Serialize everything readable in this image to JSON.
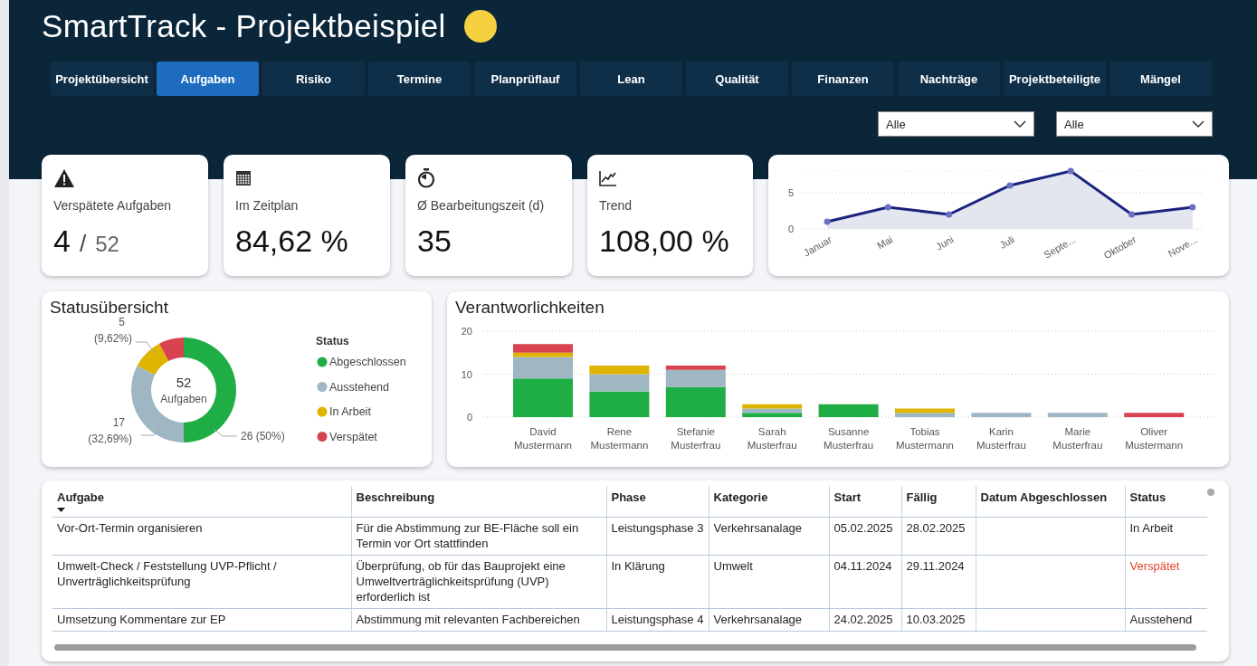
{
  "header": {
    "title": "SmartTrack - Projektbeispiel"
  },
  "tabs": [
    {
      "label": "Projektübersicht",
      "selected": false
    },
    {
      "label": "Aufgaben",
      "selected": true
    },
    {
      "label": "Risiko",
      "selected": false
    },
    {
      "label": "Termine",
      "selected": false
    },
    {
      "label": "Planprüflauf",
      "selected": false
    },
    {
      "label": "Lean",
      "selected": false
    },
    {
      "label": "Qualität",
      "selected": false
    },
    {
      "label": "Finanzen",
      "selected": false
    },
    {
      "label": "Nachträge",
      "selected": false
    },
    {
      "label": "Projektbeteiligte",
      "selected": false
    },
    {
      "label": "Mängel",
      "selected": false
    }
  ],
  "filters": [
    {
      "value": "Alle"
    },
    {
      "value": "Alle"
    }
  ],
  "kpis": [
    {
      "label": "Verspätete Aufgaben",
      "value": "4",
      "separator": "/",
      "total": "52"
    },
    {
      "label": "Im Zeitplan",
      "value": "84,62 %"
    },
    {
      "label": "Ø Bearbeitungszeit (d)",
      "value": "35"
    },
    {
      "label": "Trend",
      "value": "108,00 %"
    }
  ],
  "trend_chart": {
    "chart_data": {
      "type": "area",
      "categories": [
        "Januar",
        "Mai",
        "Juni",
        "Juli",
        "Septe...",
        "Oktober",
        "Nove..."
      ],
      "yticks": [
        0,
        5
      ],
      "ylim": [
        0,
        8
      ],
      "series": [
        {
          "color": "#1a237e",
          "values": [
            1,
            3,
            2,
            6,
            8,
            2,
            3
          ]
        }
      ]
    }
  },
  "status_overview": {
    "title": "Statusübersicht",
    "center_value": "52",
    "center_label": "Aufgaben",
    "legend_title": "Status",
    "slice_labels": [
      {
        "lines": [
          "5",
          "(9,62%)"
        ]
      },
      {
        "lines": [
          "26 (50%)"
        ]
      },
      {
        "lines": [
          "17",
          "(32,69%)"
        ]
      }
    ],
    "chart_data": {
      "type": "donut",
      "legend": "right",
      "categories": [
        "Abgeschlossen",
        "Ausstehend",
        "In Arbeit",
        "Verspätet"
      ],
      "values": [
        50,
        32.69,
        9.62,
        7.69
      ],
      "colors": [
        "#1fad45",
        "#9fb6c3",
        "#dfb400",
        "#d9434f"
      ]
    }
  },
  "responsibilities": {
    "title": "Verantworlichkeiten",
    "chart_data": {
      "type": "bar",
      "stacked": true,
      "yticks": [
        0,
        10,
        20
      ],
      "ylim": [
        0,
        20
      ],
      "categories": [
        [
          "David",
          "Mustermann"
        ],
        [
          "Rene",
          "Mustermann"
        ],
        [
          "Stefanie",
          "Musterfrau"
        ],
        [
          "Sarah",
          "Musterfrau"
        ],
        [
          "Susanne",
          "Musterfrau"
        ],
        [
          "Tobias",
          "Mustermann"
        ],
        [
          "Karin",
          "Musterfrau"
        ],
        [
          "Marie",
          "Musterfrau"
        ],
        [
          "Oliver",
          "Mustermann"
        ]
      ],
      "series": [
        {
          "color": "#1fad45",
          "values": [
            9,
            6,
            7,
            1,
            3,
            0,
            0,
            0,
            0
          ]
        },
        {
          "color": "#9fb6c3",
          "values": [
            5,
            4,
            4,
            1,
            0,
            1,
            1,
            1,
            0
          ]
        },
        {
          "color": "#dfb400",
          "values": [
            1,
            2,
            0,
            1,
            0,
            1,
            0,
            0,
            0
          ]
        },
        {
          "color": "#d9434f",
          "values": [
            2,
            0,
            1,
            0,
            0,
            0,
            0,
            0,
            1
          ]
        }
      ]
    }
  },
  "table": {
    "columns": [
      {
        "label": "Aufgabe",
        "sorted": true
      },
      {
        "label": "Beschreibung",
        "sorted": false
      },
      {
        "label": "Phase",
        "sorted": false
      },
      {
        "label": "Kategorie",
        "sorted": false
      },
      {
        "label": "Start",
        "sorted": false
      },
      {
        "label": "Fällig",
        "sorted": false
      },
      {
        "label": "Datum Abgeschlossen",
        "sorted": false
      },
      {
        "label": "Status",
        "sorted": false
      }
    ],
    "rows": [
      {
        "cells": [
          "Vor-Ort-Termin organisieren",
          "Für die Abstimmung zur BE-Fläche soll ein Termin vor Ort stattfinden",
          "Leistungsphase 3",
          "Verkehrsanalage",
          "05.02.2025",
          "28.02.2025",
          "",
          "In Arbeit"
        ],
        "color": "#252423"
      },
      {
        "cells": [
          "Umwelt-Check / Feststellung UVP-Pflicht / Unverträglichkeitsprüfung",
          "Überprüfung, ob für das Bauprojekt eine Umweltverträglichkeitsprüfung (UVP) erforderlich ist",
          "In Klärung",
          "Umwelt",
          "04.11.2024",
          "29.11.2024",
          "",
          "Verspätet"
        ],
        "color": "#e0452b"
      },
      {
        "cells": [
          "Umsetzung Kommentare zur EP",
          "Abstimmung mit relevanten Fachbereichen",
          "Leistungsphase 4",
          "Verkehrsanalage",
          "24.02.2025",
          "10.03.2025",
          "",
          "Ausstehend"
        ],
        "color": "#252423"
      }
    ]
  }
}
